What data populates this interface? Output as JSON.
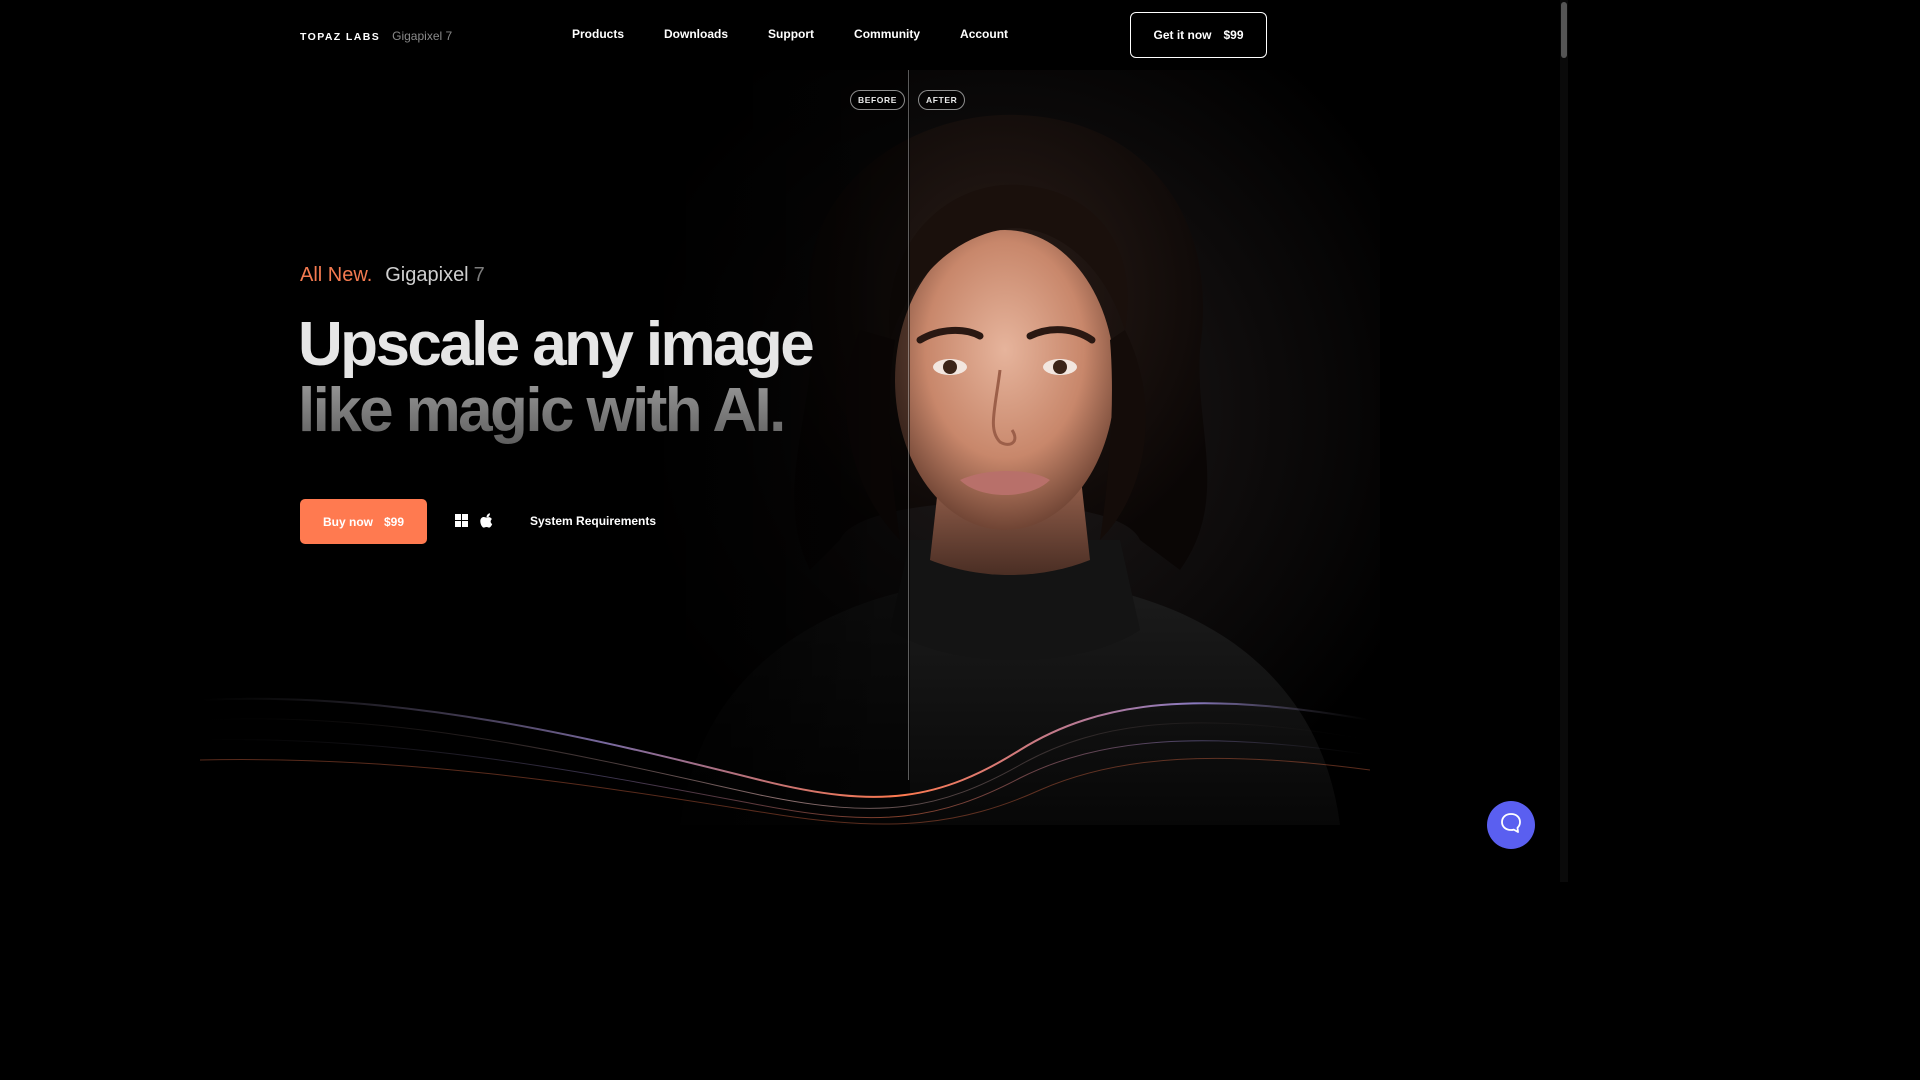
{
  "header": {
    "brand": "TOPAZ LABS",
    "product": "Gigapixel 7",
    "nav": [
      "Products",
      "Downloads",
      "Support",
      "Community",
      "Account"
    ],
    "cta_label": "Get it now",
    "cta_price": "$99"
  },
  "compare": {
    "before": "BEFORE",
    "after": "AFTER"
  },
  "hero": {
    "eyebrow_new": "All New.",
    "eyebrow_product": "Gigapixel",
    "eyebrow_version": "7",
    "headline_line1": "Upscale any image",
    "headline_line2": "like magic with AI.",
    "buy_label": "Buy now",
    "buy_price": "$99",
    "system_requirements": "System Requirements"
  },
  "icons": {
    "windows": "windows-icon",
    "apple": "apple-icon",
    "chat": "chat-icon"
  },
  "colors": {
    "accent": "#ff7a50",
    "eyebrow_accent": "#f37a50",
    "chat": "#5a5ff0",
    "background": "#000000"
  }
}
